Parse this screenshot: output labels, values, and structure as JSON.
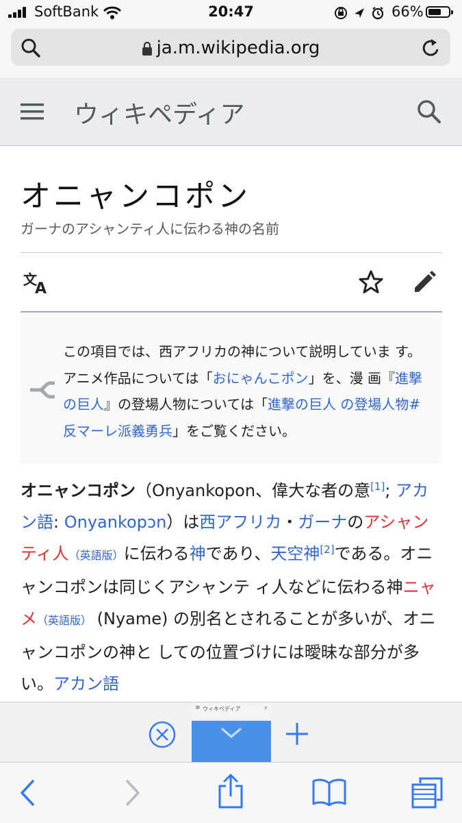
{
  "status_bar": {
    "carrier": "SoftBank",
    "time": "20:47",
    "battery_percent": "66%",
    "battery_level": 0.66
  },
  "address_bar": {
    "url": "ja.m.wikipedia.org"
  },
  "wiki_header": {
    "brand": "ウィキペディア"
  },
  "article": {
    "title": "オニャンコポン",
    "description": "ガーナのアシャンティ人に伝わる神の名前"
  },
  "hatnote": {
    "t1": "この項目では、西アフリカの神について説明していま す。アニメ作品については「",
    "link1": "おにゃんこポン",
    "t2": "」を、漫 画『",
    "link2": "進撃の巨人",
    "t3": "』の登場人物については「",
    "link3": "進撃の巨人 の登場人物#反マーレ派義勇兵",
    "t4": "」をご覧ください。"
  },
  "lead": {
    "bold_term": "オニャンコポン",
    "t1": "（Onyankopon、偉大な者の意",
    "ref1": "[1]",
    "t2": "; ",
    "link_akan": "アカン語",
    "t3": ": ",
    "link_onyankopon": "Onyankopɔn",
    "t4": "）は",
    "link_west_africa": "西アフリカ",
    "t5": "・",
    "link_ghana": "ガーナ",
    "t6": "の",
    "link_ashanti": "アシャンティ人",
    "eng1": "（英語版）",
    "t7": "に伝わる",
    "link_god": "神",
    "t8": "であり、",
    "link_sky_god": "天空神",
    "ref2": "[2]",
    "t9": "である。オニャンコポンは同じくアシャンテ ィ人などに伝わる神",
    "link_nyame": "ニャメ",
    "eng2": "（英語版）",
    "t10": " (Nyame) の別名とされることが多いが、オニャンコポンの神と しての位置づけには曖昧な部分が多い。",
    "link_akan2": "アカン語"
  },
  "tab_preview": {
    "title": "ウィキペディア"
  },
  "colors": {
    "link": "#3366cc",
    "redlink": "#dd3333",
    "accent": "#4a8fe8"
  },
  "icons": [
    "search-icon",
    "lock-icon",
    "reload-icon",
    "menu-icon",
    "language-icon",
    "star-icon",
    "pencil-icon",
    "disambiguation-icon",
    "close-tab-icon",
    "chevron-down-icon",
    "plus-icon",
    "back-icon",
    "forward-icon",
    "share-icon",
    "bookmarks-icon",
    "tabs-icon"
  ]
}
